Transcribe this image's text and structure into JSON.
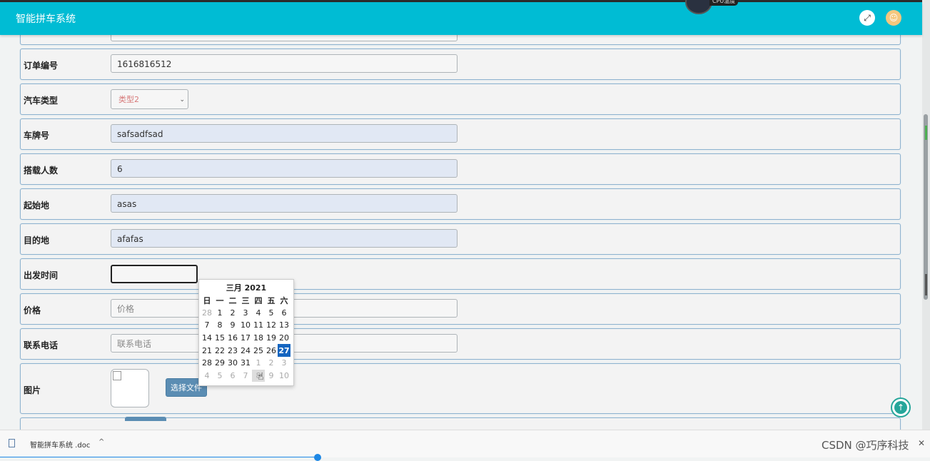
{
  "app": {
    "title": "智能拼车系统"
  },
  "header": {
    "cpu_label": "CPU温度",
    "expand_icon": "expand-arrows-icon",
    "user_icon": "user-avatar-icon"
  },
  "form": {
    "order_no": {
      "label": "订单编号",
      "value": "1616816512"
    },
    "car_type": {
      "label": "汽车类型",
      "selected": "类型2"
    },
    "plate": {
      "label": "车牌号",
      "value": "safsadfsad"
    },
    "passengers": {
      "label": "搭载人数",
      "value": "6"
    },
    "origin": {
      "label": "起始地",
      "value": "asas"
    },
    "destination": {
      "label": "目的地",
      "value": "afafas"
    },
    "depart_time": {
      "label": "出发时间",
      "value": ""
    },
    "price": {
      "label": "价格",
      "placeholder": "价格"
    },
    "phone": {
      "label": "联系电话",
      "placeholder": "联系电话"
    },
    "image": {
      "label": "图片",
      "button": "选择文件"
    }
  },
  "calendar": {
    "title": "三月 2021",
    "weekdays": [
      "日",
      "一",
      "二",
      "三",
      "四",
      "五",
      "六"
    ],
    "weeks": [
      [
        "28",
        "1",
        "2",
        "3",
        "4",
        "5",
        "6"
      ],
      [
        "7",
        "8",
        "9",
        "10",
        "11",
        "12",
        "13"
      ],
      [
        "14",
        "15",
        "16",
        "17",
        "18",
        "19",
        "20"
      ],
      [
        "21",
        "22",
        "23",
        "24",
        "25",
        "26",
        "27"
      ],
      [
        "28",
        "29",
        "30",
        "31",
        "1",
        "2",
        "3"
      ],
      [
        "4",
        "5",
        "6",
        "7",
        "8",
        "9",
        "10"
      ]
    ],
    "selected": "27"
  },
  "download_bar": {
    "filename": "智能拼车系统 .doc",
    "watermark": "CSDN @巧序科技"
  },
  "colors": {
    "header": "#00bcd4",
    "selected_day": "#1565c0",
    "fab": "#26a69a"
  }
}
